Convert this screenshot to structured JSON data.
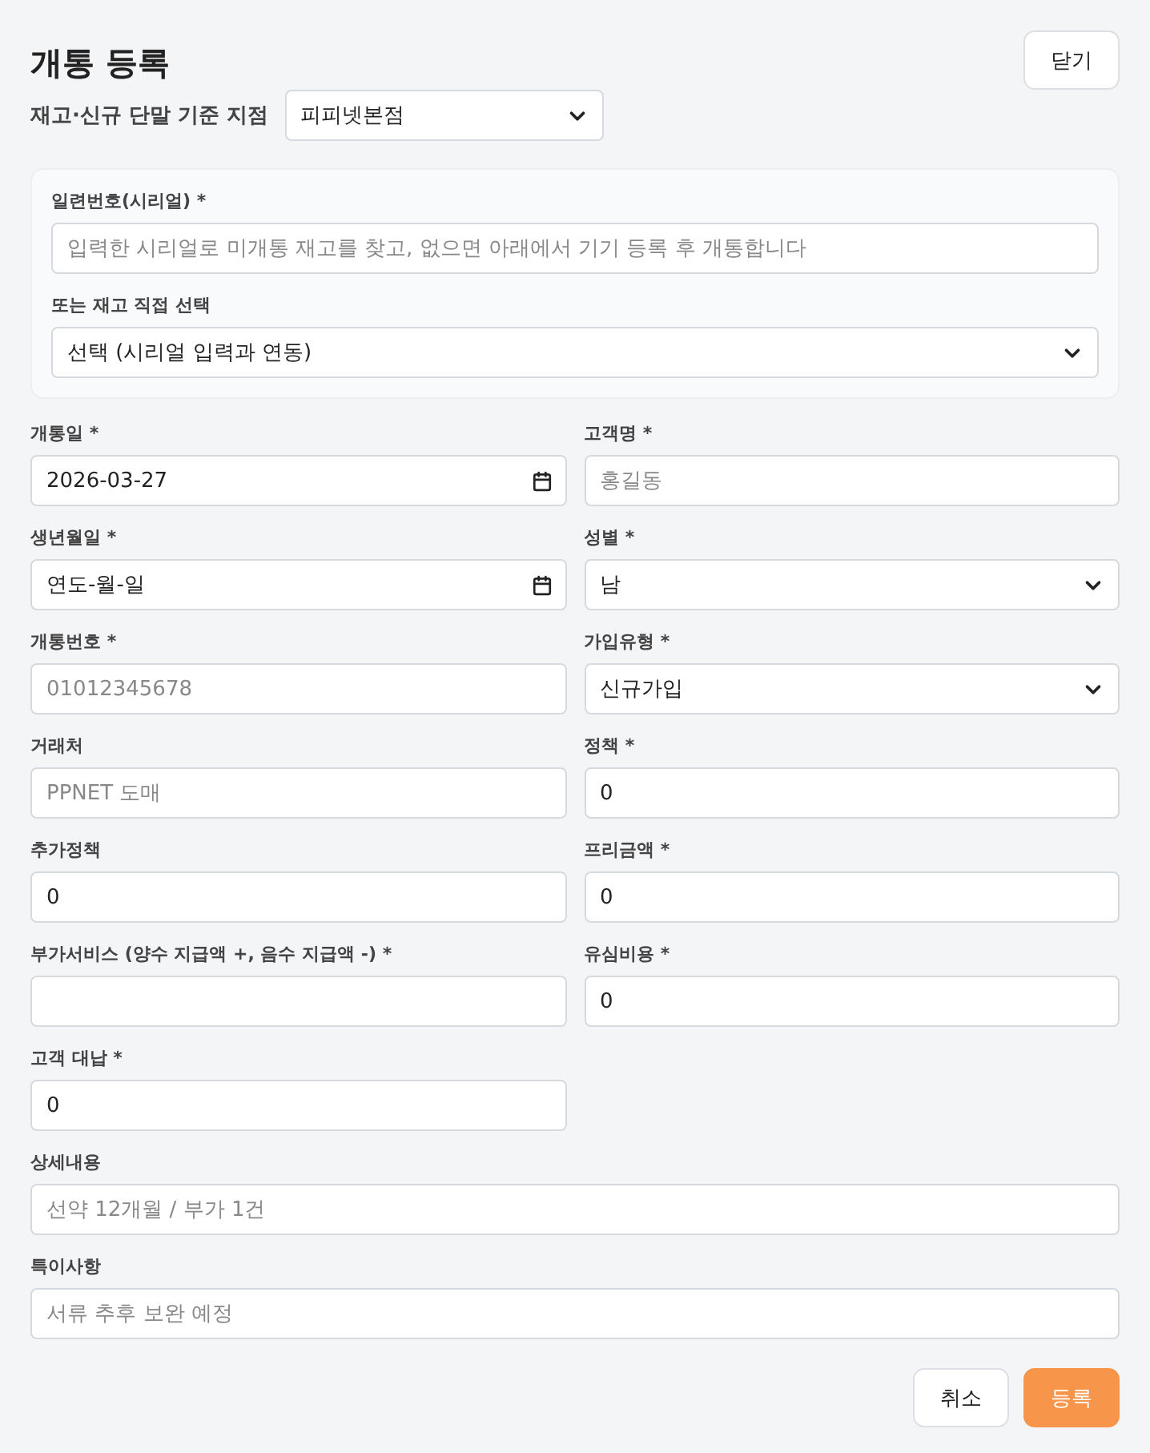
{
  "title": "개통 등록",
  "close_button": "닫기",
  "branch": {
    "label": "재고·신규 단말 기준 지점",
    "value": "피피넷본점"
  },
  "serial_panel": {
    "serial": {
      "label": "일련번호(시리얼) *",
      "placeholder": "입력한 시리얼로 미개통 재고를 찾고, 없으면 아래에서 기기 등록 후 개통합니다"
    },
    "stock": {
      "label": "또는 재고 직접 선택",
      "value": "선택 (시리얼 입력과 연동)"
    }
  },
  "fields": [
    {
      "label": "개통일 *",
      "kind": "date",
      "value": "2026-03-27",
      "wide": false
    },
    {
      "label": "고객명 *",
      "kind": "input",
      "placeholder": "홍길동",
      "wide": false
    },
    {
      "label": "생년월일 *",
      "kind": "date",
      "value": "연도-월-일",
      "wide": false
    },
    {
      "label": "성별 *",
      "kind": "select",
      "value": "남",
      "wide": false
    },
    {
      "label": "개통번호 *",
      "kind": "input",
      "placeholder": "01012345678",
      "wide": false
    },
    {
      "label": "가입유형 *",
      "kind": "select",
      "value": "신규가입",
      "wide": false
    },
    {
      "label": "거래처",
      "kind": "input",
      "placeholder": "PPNET 도매",
      "wide": false
    },
    {
      "label": "정책 *",
      "kind": "input",
      "value": "0",
      "wide": false
    },
    {
      "label": "추가정책",
      "kind": "input",
      "value": "0",
      "wide": false
    },
    {
      "label": "프리금액 *",
      "kind": "input",
      "value": "0",
      "wide": false
    },
    {
      "label": "부가서비스 (양수 지급액 +, 음수 지급액 -) *",
      "kind": "input",
      "wide": false
    },
    {
      "label": "유심비용 *",
      "kind": "input",
      "value": "0",
      "wide": false
    },
    {
      "label": "고객 대납 *",
      "kind": "input",
      "value": "0",
      "wide": false
    },
    {
      "label": "상세내용",
      "kind": "input",
      "placeholder": "선약 12개월 / 부가 1건",
      "wide": true
    },
    {
      "label": "특이사항",
      "kind": "input",
      "placeholder": "서류 추후 보완 예정",
      "wide": true
    }
  ],
  "buttons": [
    {
      "label": "취소",
      "kind": "secondary"
    },
    {
      "label": "등록",
      "kind": "primary"
    }
  ]
}
